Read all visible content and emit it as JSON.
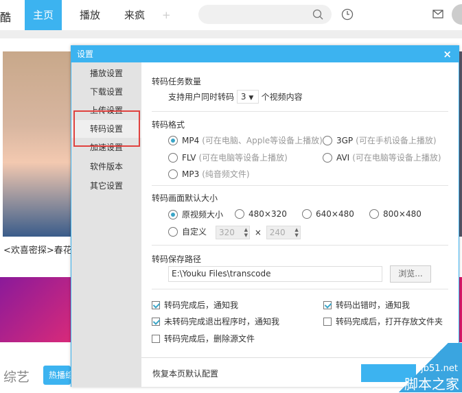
{
  "topnav": {
    "logo": "酷",
    "tabs": [
      "主页",
      "播放",
      "来疯"
    ],
    "add": "+"
  },
  "page": {
    "caption": "<欢喜密探>春花",
    "section": "综艺",
    "hot_button": "热播综艺"
  },
  "dialog": {
    "title": "设置",
    "close": "×",
    "sidebar": [
      "播放设置",
      "下载设置",
      "上传设置",
      "转码设置",
      "加速设置",
      "软件版本",
      "其它设置"
    ],
    "task": {
      "heading": "转码任务数量",
      "prefix": "支持用户同时转码",
      "value": "3",
      "suffix": "个视频内容"
    },
    "format": {
      "heading": "转码格式",
      "options": [
        {
          "label": "MP4",
          "note": "(可在电脑、Apple等设备上播放)",
          "selected": true
        },
        {
          "label": "3GP",
          "note": "(可在手机设备上播放)",
          "selected": false
        },
        {
          "label": "FLV",
          "note": "(可在电脑等设备上播放)",
          "selected": false
        },
        {
          "label": "AVI",
          "note": "(可在电脑等设备上播放)",
          "selected": false
        },
        {
          "label": "MP3",
          "note": "(纯音频文件)",
          "selected": false
        }
      ]
    },
    "size": {
      "heading": "转码画面默认大小",
      "options": [
        {
          "label": "原视频大小",
          "selected": true
        },
        {
          "label": "480×320",
          "selected": false
        },
        {
          "label": "640×480",
          "selected": false
        },
        {
          "label": "800×480",
          "selected": false
        },
        {
          "label": "自定义",
          "selected": false
        }
      ],
      "width": "320",
      "times": "×",
      "height": "240"
    },
    "path": {
      "heading": "转码保存路径",
      "value": "E:\\Youku Files\\transcode",
      "browse": "浏览..."
    },
    "checks": [
      {
        "label": "转码完成后，通知我",
        "checked": true
      },
      {
        "label": "转码出错时，通知我",
        "checked": true
      },
      {
        "label": "未转码完成退出程序时，通知我",
        "checked": true
      },
      {
        "label": "转码完成后，打开存放文件夹",
        "checked": false
      },
      {
        "label": "转码完成后，删除源文件",
        "checked": false
      }
    ],
    "restore": "恢复本页默认配置"
  },
  "watermark": {
    "line1": "jb51.net",
    "line2": "脚本之家"
  }
}
